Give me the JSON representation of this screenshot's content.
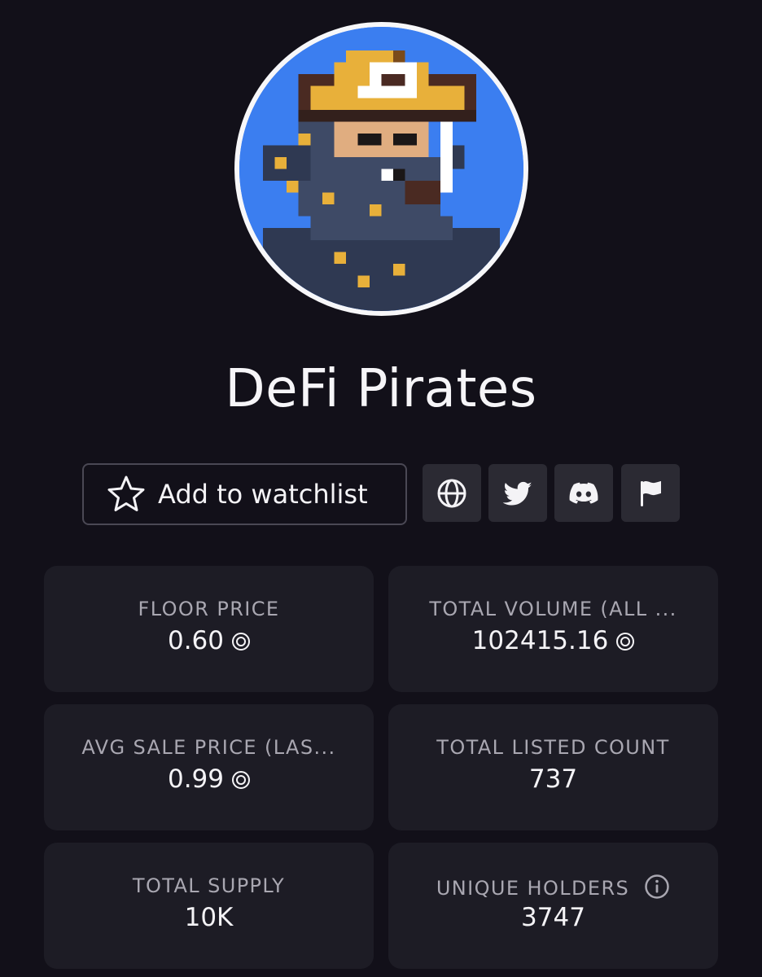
{
  "collection": {
    "name": "DeFi Pirates",
    "avatar_icon": "pixel-pirate-avatar"
  },
  "actions": {
    "watchlist_label": "Add to watchlist",
    "watchlist_icon": "star-icon",
    "links": [
      {
        "icon": "globe-icon",
        "name": "website"
      },
      {
        "icon": "twitter-icon",
        "name": "twitter"
      },
      {
        "icon": "discord-icon",
        "name": "discord"
      },
      {
        "icon": "flag-icon",
        "name": "report"
      }
    ]
  },
  "stats": [
    {
      "label": "FLOOR PRICE",
      "value": "0.60",
      "currency_icon": "solana-icon"
    },
    {
      "label": "TOTAL VOLUME (ALL ...",
      "value": "102415.16",
      "currency_icon": "solana-icon"
    },
    {
      "label": "AVG SALE PRICE (LAS...",
      "value": "0.99",
      "currency_icon": "solana-icon"
    },
    {
      "label": "TOTAL LISTED COUNT",
      "value": "737"
    },
    {
      "label": "TOTAL SUPPLY",
      "value": "10K"
    },
    {
      "label": "UNIQUE HOLDERS",
      "value": "3747",
      "info_icon": "info-icon"
    }
  ],
  "colors": {
    "background": "#121019",
    "card": "#1d1c25",
    "icon_button": "#2b2a33",
    "text": "#f4f3f6",
    "muted_text": "#a9a7b1",
    "avatar_bg": "#3b7ef0"
  }
}
